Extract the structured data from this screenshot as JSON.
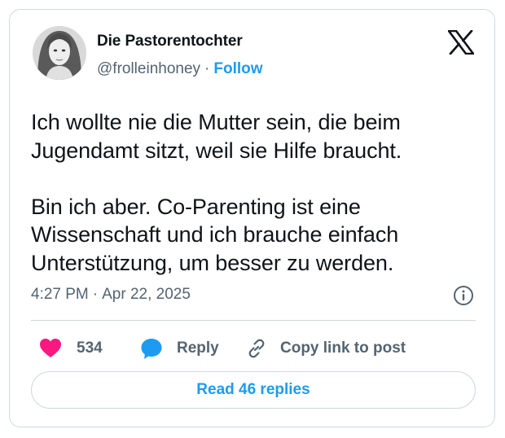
{
  "tweet": {
    "author": {
      "display_name": "Die Pastorentochter",
      "handle": "@frolleinhoney",
      "separator": "·",
      "follow_label": "Follow"
    },
    "text": "Ich wollte nie die Mutter sein, die beim\nJugendamt sitzt, weil sie Hilfe braucht.\n\nBin ich aber. Co-Parenting ist eine\nWissenschaft und ich brauche einfach\nUnterstützung, um besser zu werden.",
    "time": "4:27 PM",
    "meta_separator": "·",
    "date": "Apr 22, 2025",
    "actions": {
      "like_count": "534",
      "reply_label": "Reply",
      "copy_link_label": "Copy link to post"
    },
    "read_replies_label": "Read 46 replies"
  },
  "icons": {
    "avatar": "avatar-photo",
    "logo": "x-logo-icon",
    "info": "info-icon",
    "like": "heart-icon",
    "reply": "speech-bubble-icon",
    "copy": "link-icon"
  },
  "colors": {
    "accent": "#1d9bf0",
    "like": "#f91880",
    "secondary_text": "#536471",
    "primary_text": "#0f1419",
    "border": "#cfd9de"
  }
}
